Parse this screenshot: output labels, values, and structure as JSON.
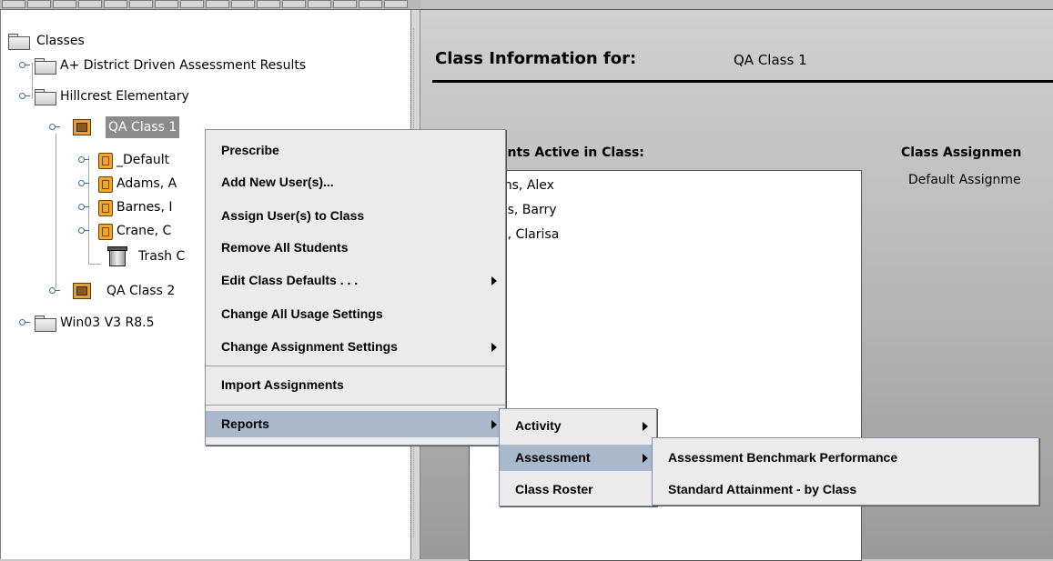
{
  "tree": {
    "root": "Classes",
    "nodes": [
      "A+ District Driven Assessment Results",
      "Hillcrest Elementary",
      "QA Class 1",
      "_Default",
      "Adams, A",
      "Barnes, I",
      "Crane, C",
      "Trash C",
      "QA Class 2",
      "Win03 V3 R8.5"
    ]
  },
  "panel": {
    "title": "Class Information for:",
    "class_name": "QA Class 1",
    "students_label": "ents Active in Class:",
    "assignments_label": "Class Assignmen",
    "assignments_value": "Default Assignme",
    "students": [
      "ms, Alex",
      "es, Barry",
      "e, Clarisa"
    ]
  },
  "context_menu": {
    "items": [
      "Prescribe",
      "Add New User(s)...",
      "Assign User(s) to Class",
      "Remove All Students",
      "Edit Class Defaults . . .",
      "Change All Usage Settings",
      "Change Assignment Settings",
      "Import Assignments",
      "Reports"
    ]
  },
  "reports_submenu": {
    "items": [
      "Activity",
      "Assessment",
      "Class Roster"
    ]
  },
  "assessment_submenu": {
    "items": [
      "Assessment Benchmark Performance",
      "Standard Attainment - by Class"
    ]
  },
  "colors": {
    "menu_background": "#ebebeb",
    "menu_highlight": "#aab8cc",
    "tree_selection": "#8b8b8b"
  }
}
